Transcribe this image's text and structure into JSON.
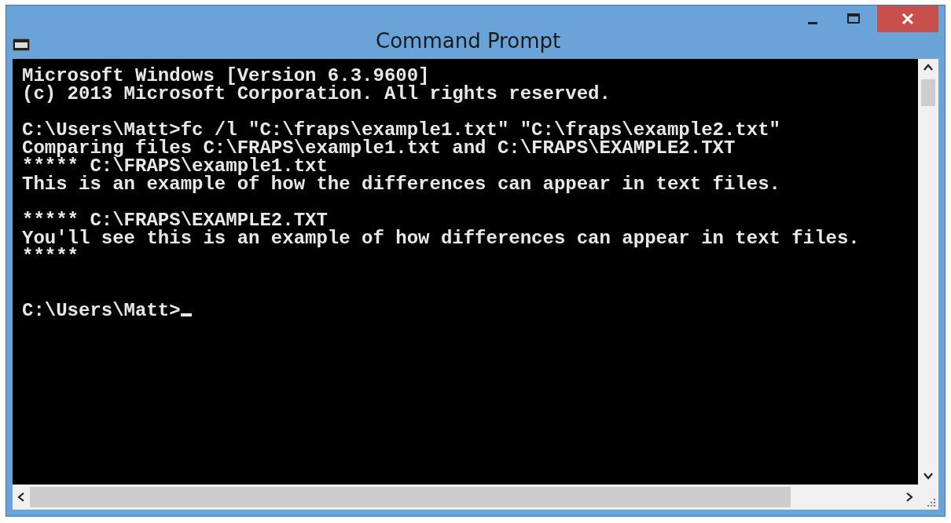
{
  "window": {
    "title": "Command Prompt"
  },
  "console": {
    "blocks": [
      [
        "Microsoft Windows [Version 6.3.9600]",
        "(c) 2013 Microsoft Corporation. All rights reserved."
      ],
      [
        "C:\\Users\\Matt>fc /l \"C:\\fraps\\example1.txt\" \"C:\\fraps\\example2.txt\"",
        "Comparing files C:\\FRAPS\\example1.txt and C:\\FRAPS\\EXAMPLE2.TXT",
        "***** C:\\FRAPS\\example1.txt",
        "This is an example of how the differences can appear in text files."
      ],
      [
        "***** C:\\FRAPS\\EXAMPLE2.TXT",
        "You'll see this is an example of how differences can appear in text files.",
        "*****"
      ]
    ],
    "prompt": "C:\\Users\\Matt>",
    "cursor": true
  }
}
